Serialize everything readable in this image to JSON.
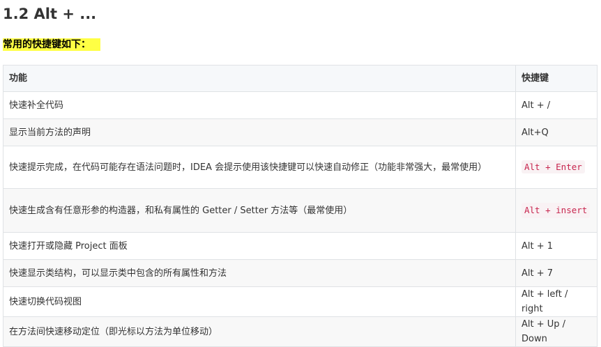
{
  "heading": "1.2 Alt + ...",
  "intro": "常用的快捷键如下：",
  "table": {
    "headers": [
      "功能",
      "快捷键"
    ],
    "rows": [
      {
        "feature": "快速补全代码",
        "shortcut": "Alt + /",
        "code": false
      },
      {
        "feature": "显示当前方法的声明",
        "shortcut": "Alt+Q",
        "code": false
      },
      {
        "feature": "快速提示完成，在代码可能存在语法问题时，IDEA 会提示使用该快捷键可以快速自动修正（功能非常强大，最常使用）",
        "shortcut": "Alt + Enter",
        "code": true
      },
      {
        "feature": "快速生成含有任意形参的构造器，和私有属性的 Getter / Setter 方法等（最常使用）",
        "shortcut": "Alt + insert",
        "code": true
      },
      {
        "feature": "快速打开或隐藏 Project 面板",
        "shortcut": "Alt + 1",
        "code": false
      },
      {
        "feature": "快速显示类结构，可以显示类中包含的所有属性和方法",
        "shortcut": "Alt + 7",
        "code": false
      },
      {
        "feature": "快速切换代码视图",
        "shortcut": "Alt + left / right",
        "code": false
      },
      {
        "feature": "在方法间快速移动定位（即光标以方法为单位移动）",
        "shortcut": "Alt + Up / Down",
        "code": false
      }
    ]
  }
}
